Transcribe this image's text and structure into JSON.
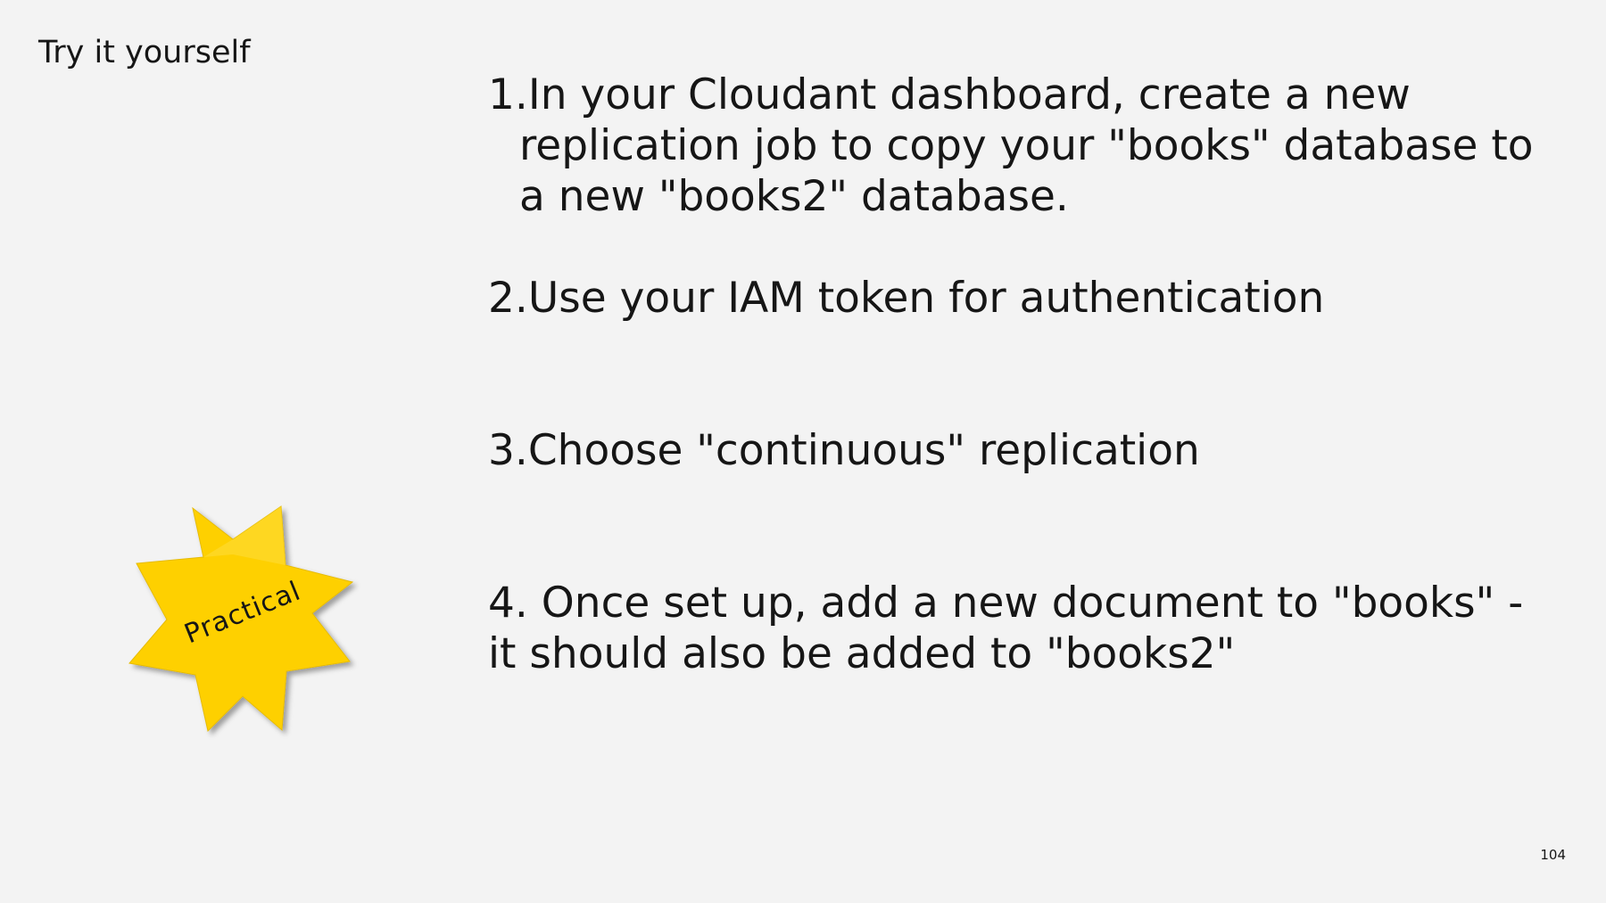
{
  "slide": {
    "title": "Try it yourself",
    "page_number": "104"
  },
  "steps": [
    {
      "number": "1.",
      "text": "In your Cloudant dashboard, create a new replication job to copy your \"books\" database to a new \"books2\" database."
    },
    {
      "number": "2.",
      "text": "Use your IAM token for authentication"
    },
    {
      "number": "3.",
      "text": "Choose \"continuous\" replication"
    },
    {
      "number": "4.",
      "text": " Once set up, add a new document to \"books\" - it should also be added to \"books2\""
    }
  ],
  "badge": {
    "label": "Practical",
    "icon": "starburst-badge-icon",
    "color": "#fed000"
  }
}
